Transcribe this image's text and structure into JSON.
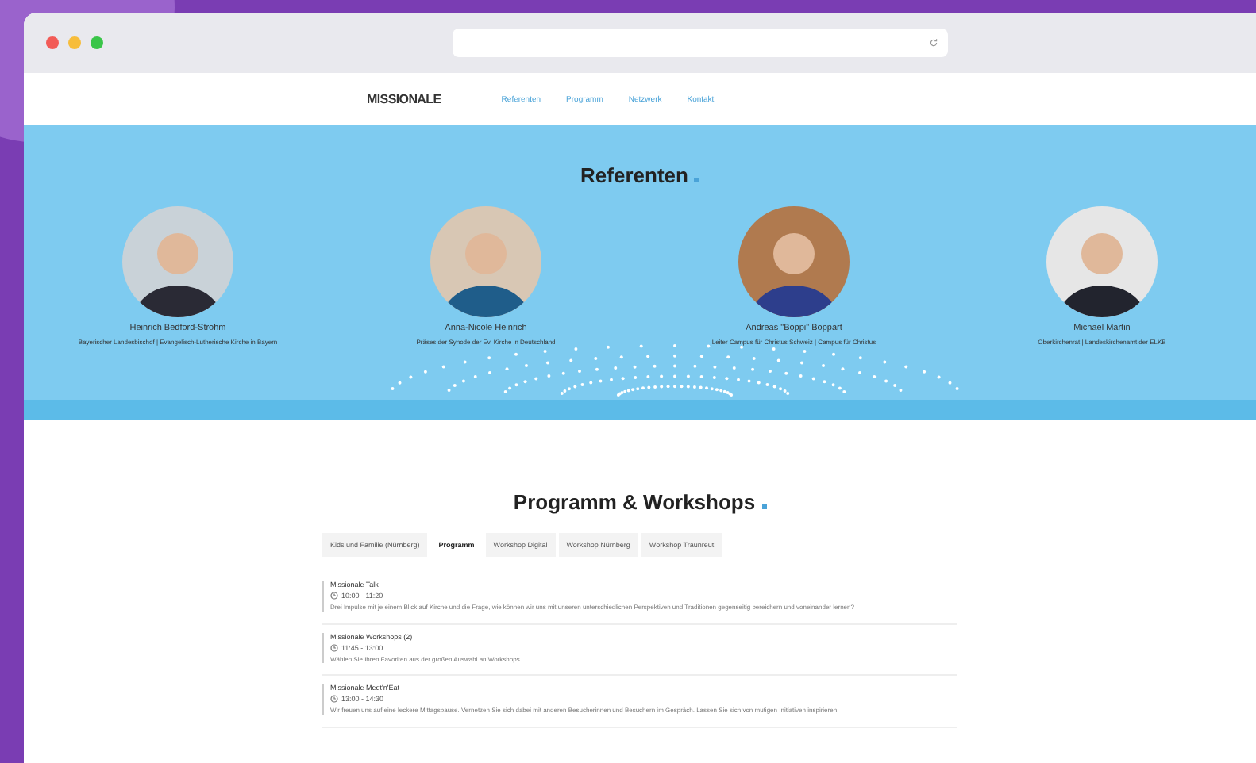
{
  "nav": {
    "logo": "MISSIONALE",
    "links": [
      "Referenten",
      "Programm",
      "Netzwerk",
      "Kontakt"
    ]
  },
  "speakers_section": {
    "title": "Referenten",
    "speakers": [
      {
        "name": "Heinrich Bedford-Strohm",
        "role": "Bayerischer Landesbischof | Evangelisch-Lutherische Kirche in Bayern"
      },
      {
        "name": "Anna-Nicole Heinrich",
        "role": "Präses der Synode der Ev. Kirche in Deutschland"
      },
      {
        "name": "Andreas \"Boppi\" Boppart",
        "role": "Leiter Campus für Christus Schweiz | Campus für Christus"
      },
      {
        "name": "Michael Martin",
        "role": "Oberkirchenrat | Landeskirchenamt der ELKB"
      }
    ]
  },
  "program_section": {
    "title": "Programm & Workshops",
    "tabs": [
      {
        "label": "Kids und Familie (Nürnberg)",
        "selected": false
      },
      {
        "label": "Programm",
        "selected": true
      },
      {
        "label": "Workshop Digital",
        "selected": false
      },
      {
        "label": "Workshop Nürnberg",
        "selected": false
      },
      {
        "label": "Workshop Traunreut",
        "selected": false
      }
    ],
    "items": [
      {
        "title": "Missionale Talk",
        "time": "10:00  -  11:20",
        "description": "Drei Impulse mit je einem Blick auf Kirche und die Frage, wie können wir uns mit unseren unterschiedlichen Perspektiven und Traditionen gegenseitig bereichern und voneinander lernen?"
      },
      {
        "title": "Missionale Workshops (2)",
        "time": "11:45  -  13:00",
        "description": "Wählen Sie Ihren Favoriten aus der großen Auswahl an Workshops"
      },
      {
        "title": "Missionale Meet'n'Eat",
        "time": "13:00  -  14:30",
        "description": "Wir freuen uns auf eine leckere Mittagspause. Vernetzen Sie sich dabei mit anderen Besucherinnen und Besuchern im Gespräch. Lassen Sie sich von mutigen Initiativen inspirieren."
      }
    ]
  }
}
